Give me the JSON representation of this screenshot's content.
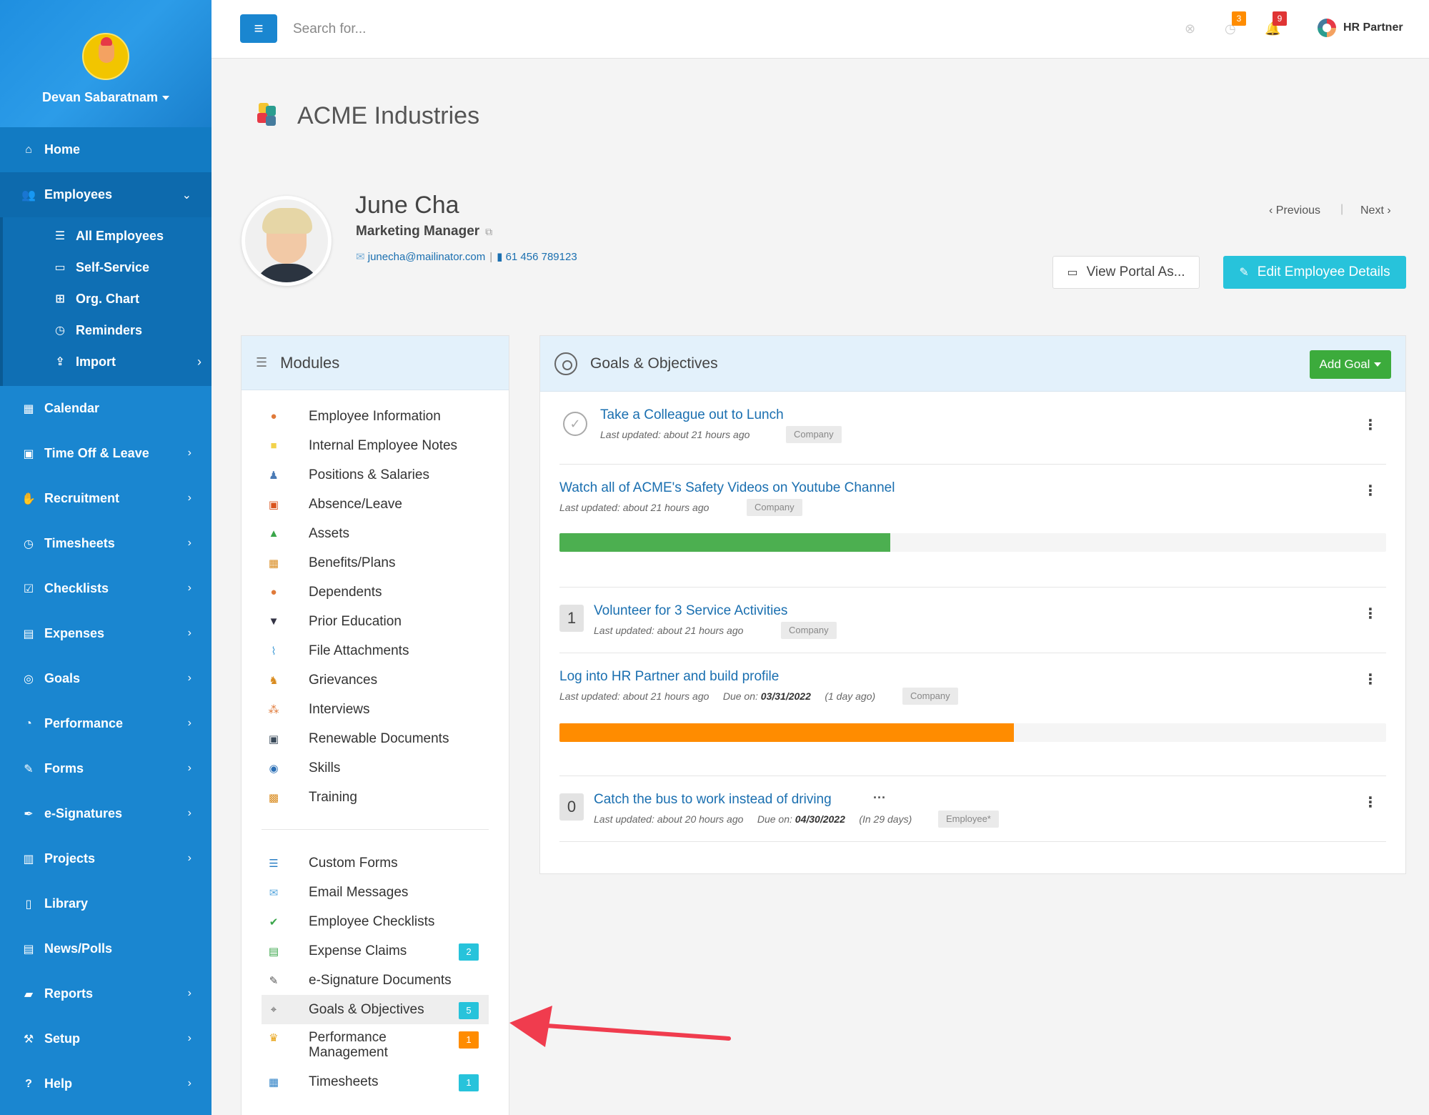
{
  "sidebar": {
    "user_name": "Devan Sabaratnam",
    "home": "Home",
    "employees": "Employees",
    "sub": [
      "All Employees",
      "Self-Service",
      "Org. Chart",
      "Reminders",
      "Import"
    ],
    "items": [
      "Calendar",
      "Time Off & Leave",
      "Recruitment",
      "Timesheets",
      "Checklists",
      "Expenses",
      "Goals",
      "Performance",
      "Forms",
      "e-Signatures",
      "Projects",
      "Library",
      "News/Polls",
      "Reports",
      "Setup",
      "Help"
    ]
  },
  "topbar": {
    "search_placeholder": "Search for...",
    "badge_tasks": "3",
    "badge_notifications": "9",
    "brand": "HR Partner"
  },
  "company": {
    "name": "ACME Industries"
  },
  "employee": {
    "name": "June Cha",
    "title": "Marketing Manager",
    "email": "junecha@mailinator.com",
    "phone": "61 456 789123",
    "previous": "Previous",
    "next": "Next",
    "view_portal": "View Portal As...",
    "edit": "Edit Employee Details"
  },
  "modules": {
    "title": "Modules",
    "items": [
      "Employee Information",
      "Internal Employee Notes",
      "Positions & Salaries",
      "Absence/Leave",
      "Assets",
      "Benefits/Plans",
      "Dependents",
      "Prior Education",
      "File Attachments",
      "Grievances",
      "Interviews",
      "Renewable Documents",
      "Skills",
      "Training"
    ],
    "items2": [
      "Custom Forms",
      "Email Messages",
      "Employee Checklists",
      "Expense Claims",
      "e-Signature Documents",
      "Goals & Objectives",
      "Performance Management",
      "Timesheets"
    ],
    "badges": {
      "expense_claims": "2",
      "goals": "5",
      "performance": "1",
      "timesheets": "1"
    }
  },
  "goals": {
    "title": "Goals & Objectives",
    "add_label": "Add Goal",
    "list": [
      {
        "title": "Take a Colleague out to Lunch",
        "meta": "Last updated: about 21 hours ago",
        "tag": "Company"
      },
      {
        "title": "Watch all of ACME's Safety Videos on Youtube Channel",
        "meta": "Last updated: about 21 hours ago",
        "tag": "Company",
        "progress": 40
      },
      {
        "number": "1",
        "title": "Volunteer for 3 Service Activities",
        "meta": "Last updated: about 21 hours ago",
        "tag": "Company"
      },
      {
        "title": "Log into HR Partner and build profile",
        "meta": "Last updated: about 21 hours ago",
        "due_label": "Due on:",
        "due": "03/31/2022",
        "due_rel": "(1 day ago)",
        "tag": "Company",
        "progress": 55
      },
      {
        "number": "0",
        "title": "Catch the bus to work instead of driving",
        "meta": "Last updated: about 20 hours ago",
        "due_label": "Due on:",
        "due": "04/30/2022",
        "due_rel": "(In 29 days)",
        "tag": "Employee*"
      }
    ]
  },
  "colors": {
    "sidebar": "#1a86d0",
    "accent": "#27c3db",
    "add_goal": "#3cab3c",
    "progress_green": "#4caf50",
    "progress_orange": "#ff8c00",
    "badge_teal": "#27c3db",
    "badge_orange": "#ff8c00",
    "annotation_arrow": "#f03c4e"
  }
}
